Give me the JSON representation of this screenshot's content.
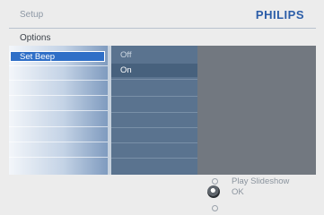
{
  "header": {
    "title": "Setup",
    "brand": "PHILIPS"
  },
  "menu": {
    "title": "Options"
  },
  "left_column": {
    "items": [
      "Set Beep"
    ]
  },
  "submenu": {
    "options": [
      "Off",
      "On"
    ],
    "selected": "On"
  },
  "hints": {
    "up": "Play Slideshow",
    "ok": "OK"
  },
  "colors": {
    "brand": "#2b5da8",
    "selected_item": "#2f6fc7",
    "panel": "#5a738f"
  }
}
